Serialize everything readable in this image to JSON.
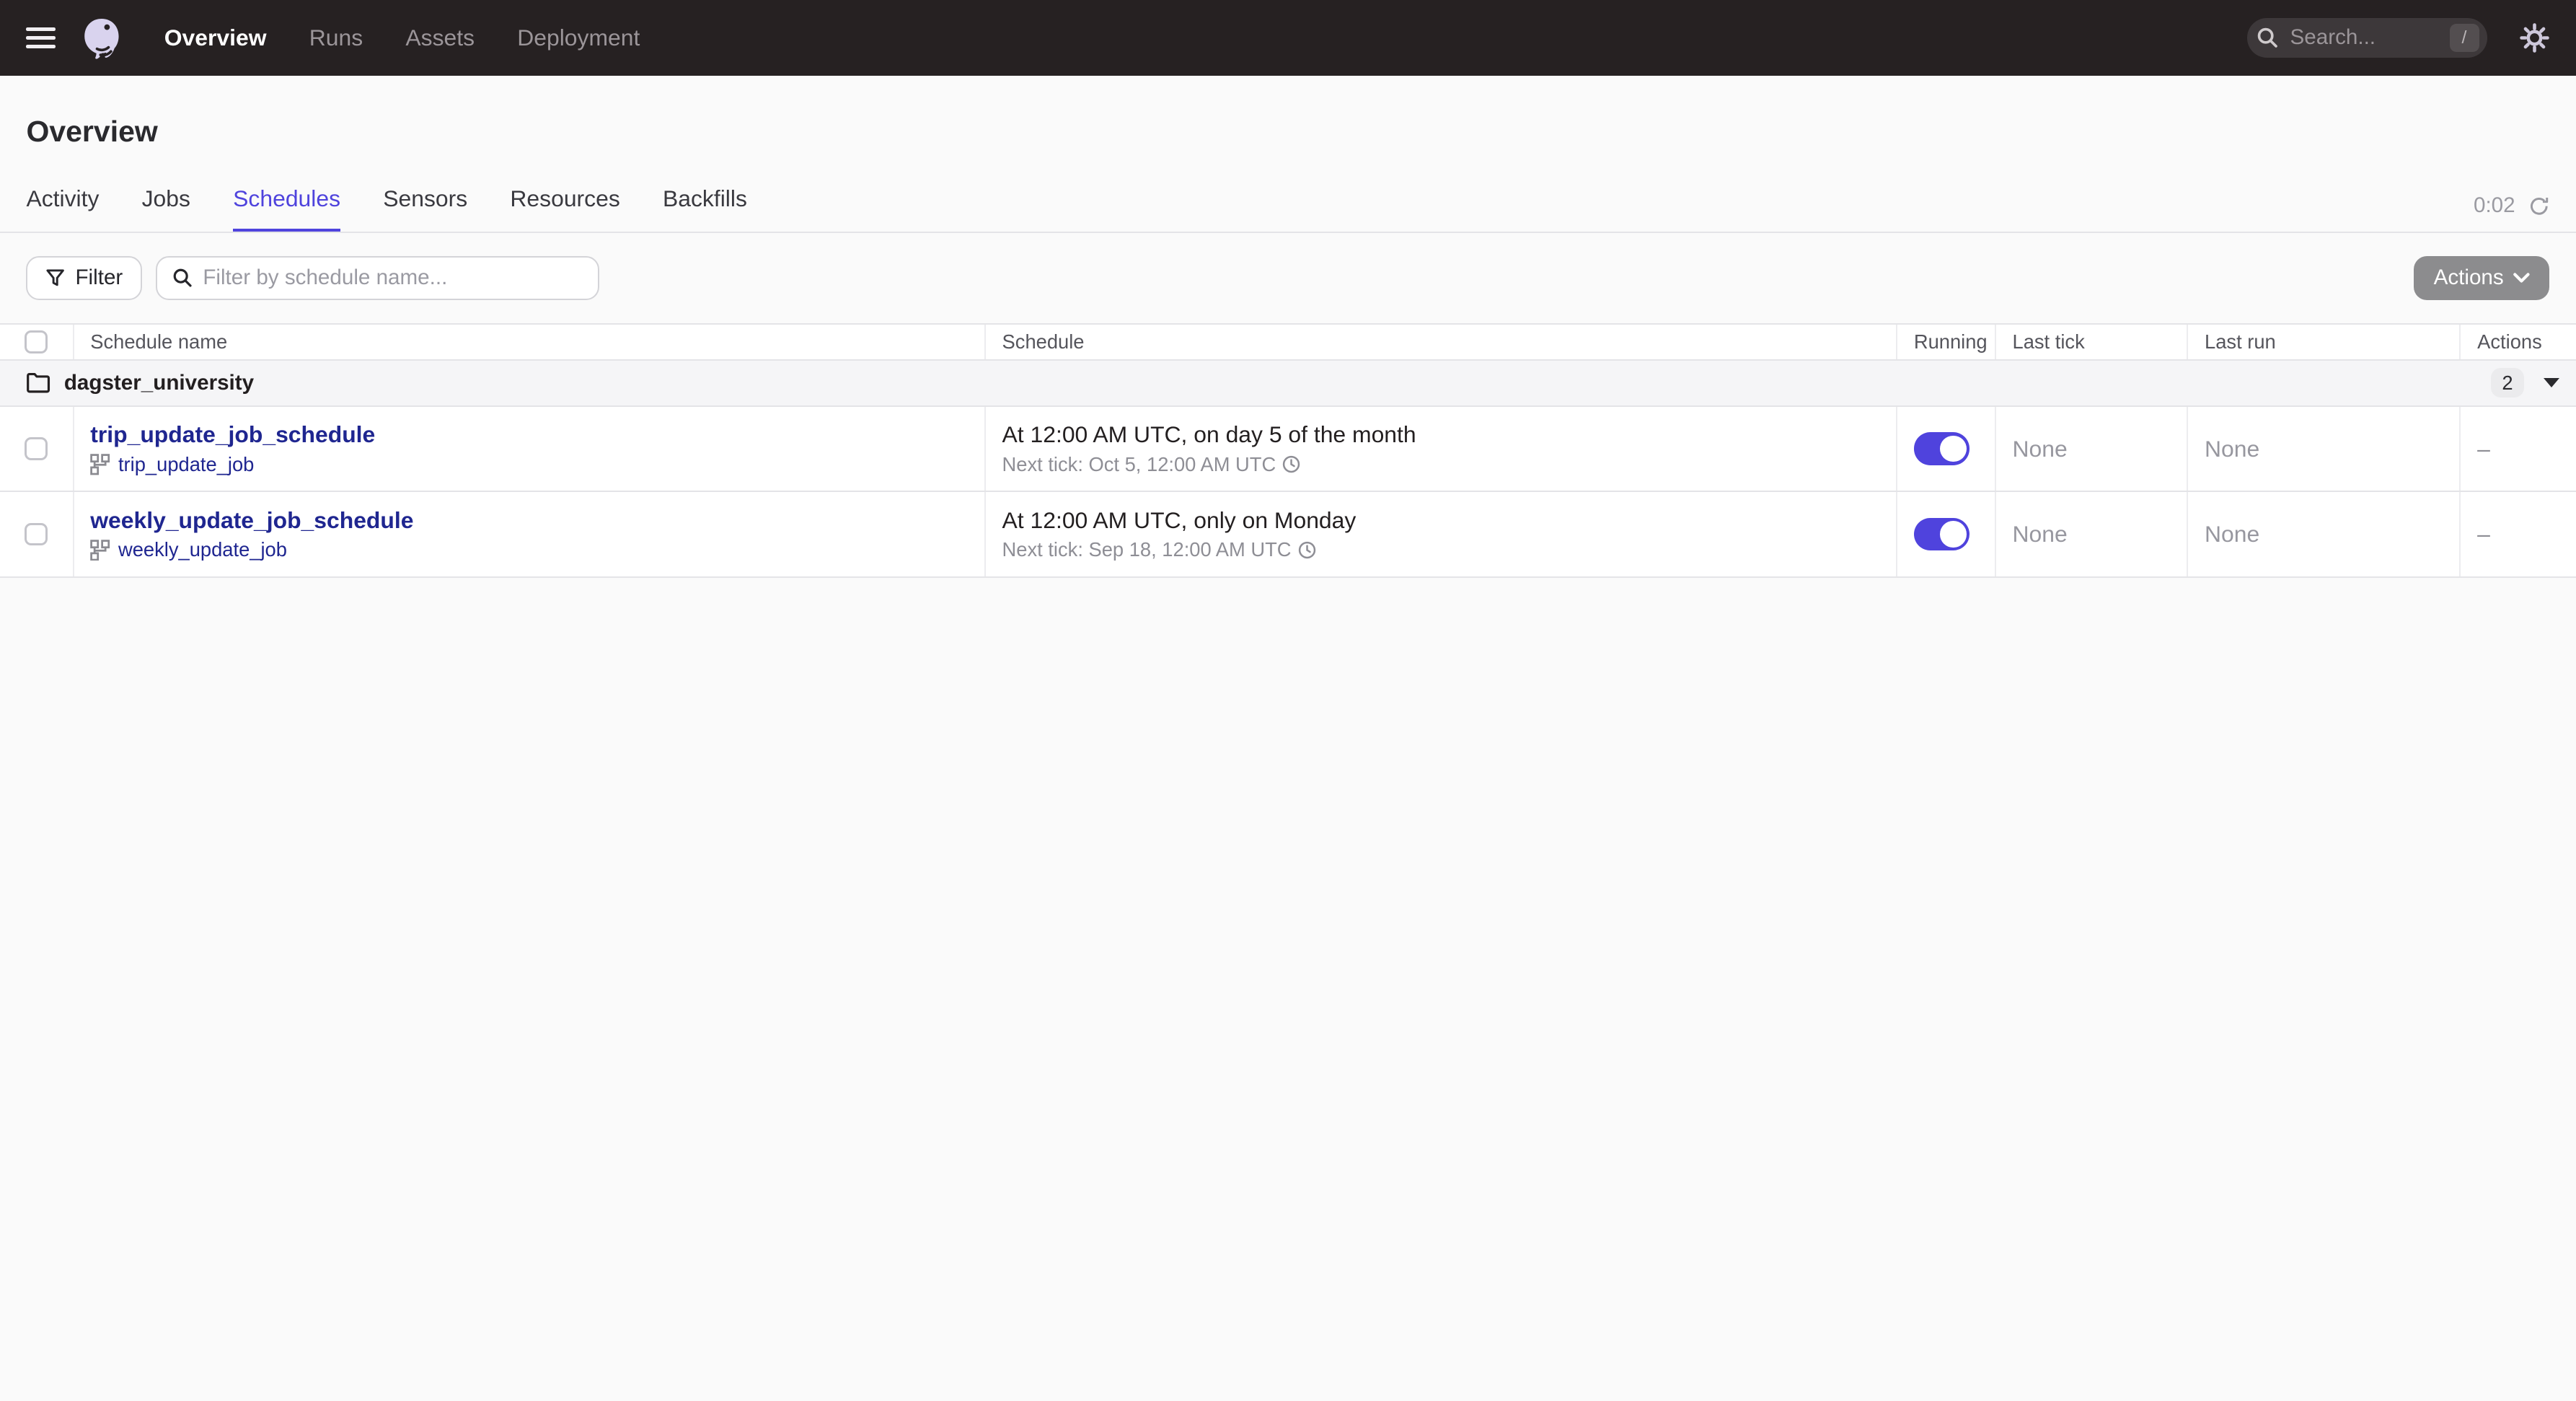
{
  "nav": {
    "menu": [
      {
        "label": "Overview"
      },
      {
        "label": "Runs"
      },
      {
        "label": "Assets"
      },
      {
        "label": "Deployment"
      }
    ],
    "search": {
      "placeholder": "Search...",
      "shortcut": "/"
    }
  },
  "page": {
    "title": "Overview"
  },
  "tabs": {
    "items": [
      {
        "label": "Activity"
      },
      {
        "label": "Jobs"
      },
      {
        "label": "Schedules"
      },
      {
        "label": "Sensors"
      },
      {
        "label": "Resources"
      },
      {
        "label": "Backfills"
      }
    ],
    "active_tab": "Schedules",
    "refresh_timer": "0:02"
  },
  "toolbar": {
    "filter_button": "Filter",
    "filter_placeholder": "Filter by schedule name...",
    "actions_button": "Actions"
  },
  "table": {
    "headers": {
      "schedule_name": "Schedule name",
      "schedule": "Schedule",
      "running": "Running",
      "last_tick": "Last tick",
      "last_run": "Last run",
      "actions": "Actions"
    },
    "group": {
      "name": "dagster_university",
      "count": "2"
    },
    "rows": [
      {
        "name": "trip_update_job_schedule",
        "job": "trip_update_job",
        "cron": "At 12:00 AM UTC, on day 5 of the month",
        "next_tick": "Next tick: Oct 5, 12:00 AM UTC",
        "running": true,
        "last_tick": "None",
        "last_run": "None",
        "actions": "–"
      },
      {
        "name": "weekly_update_job_schedule",
        "job": "weekly_update_job",
        "cron": "At 12:00 AM UTC, only on Monday",
        "next_tick": "Next tick: Sep 18, 12:00 AM UTC",
        "running": true,
        "last_tick": "None",
        "last_run": "None",
        "actions": "–"
      }
    ]
  },
  "colors": {
    "accent": "#4F43DD",
    "link": "#1F2690",
    "nav_background": "#262122",
    "logo": "#D9D3EE"
  }
}
